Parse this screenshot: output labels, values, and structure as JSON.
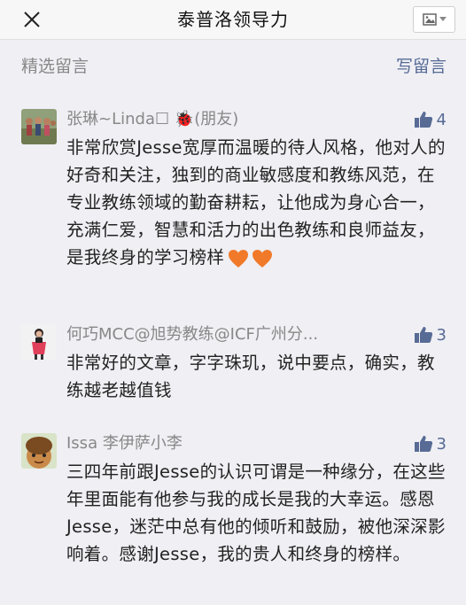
{
  "header": {
    "title": "泰普洛领导力"
  },
  "section": {
    "title": "精选留言",
    "write_label": "写留言"
  },
  "comments": [
    {
      "nickname": "张琳~Linda☐ 🐞(朋友)",
      "likes": "4",
      "text": "非常欣赏Jesse宽厚而温暖的待人风格，他对人的好奇和关注，独到的商业敏感度和教练风范，在专业教练领域的勤奋耕耘，让他成为身心合一，充满仁爱，智慧和活力的出色教练和良师益友，是我终身的学习榜样"
    },
    {
      "nickname": "何巧MCC@旭势教练@ICF广州分...",
      "likes": "3",
      "text": "非常好的文章，字字珠玑，说中要点，确实，教练越老越值钱"
    },
    {
      "nickname": "Issa 李伊萨小李",
      "likes": "3",
      "text": "三四年前跟Jesse的认识可谓是一种缘分，在这些年里面能有他参与我的成长是我的大幸运。感恩Jesse，迷茫中总有他的倾听和鼓励，被他深深影响着。感谢Jesse，我的贵人和终身的榜样。"
    }
  ],
  "colors": {
    "link": "#576b95",
    "muted": "#888888",
    "heart": "#f07a2a"
  }
}
